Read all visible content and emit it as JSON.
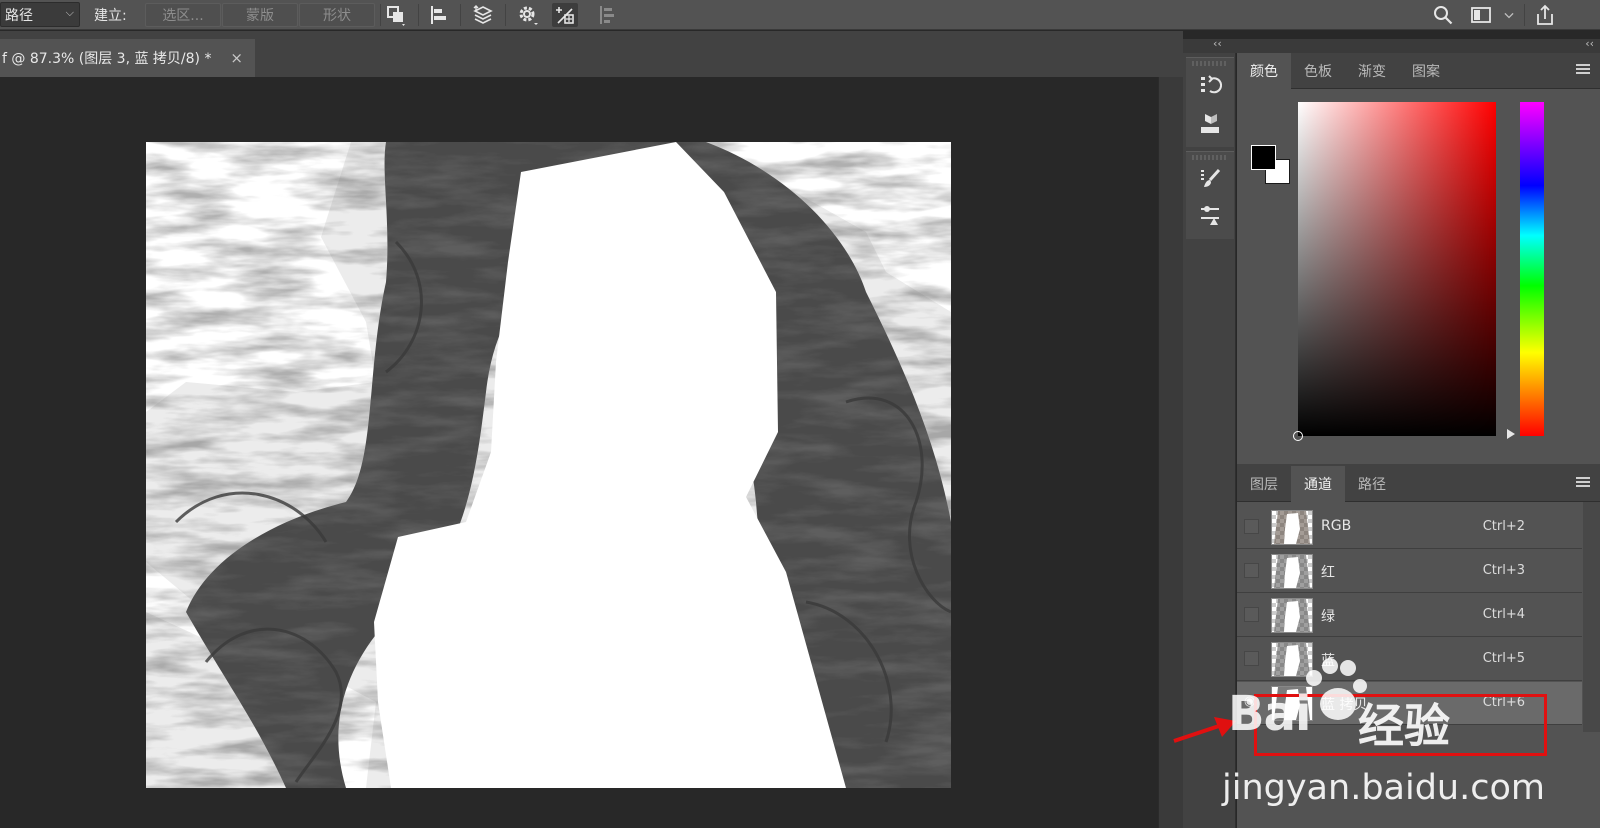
{
  "options_bar": {
    "mode_value": "路径",
    "make_label": "建立:",
    "selection_button": "选区...",
    "mask_button": "蒙版",
    "shape_button": "形状",
    "icons": [
      "path-operations-icon",
      "path-alignment-icon",
      "path-arrangement-icon",
      "settings-gear-icon",
      "constrain-path-icon",
      "align-edges-icon",
      "search-icon",
      "workspace-icon",
      "share-icon"
    ]
  },
  "document_tab": {
    "title": "f @ 87.3% (图层 3, 蓝 拷贝/8) *",
    "close": "×"
  },
  "dock": {
    "collapse_left": "‹‹",
    "collapse_right": "‹‹",
    "strip_icons": [
      "history-icon",
      "3d-materials-icon",
      "brush-settings-icon",
      "adjustments-icon"
    ]
  },
  "color_panel": {
    "tabs": [
      "颜色",
      "色板",
      "渐变",
      "图案"
    ],
    "active_tab": "颜色",
    "foreground_color": "#000000",
    "background_color": "#ffffff",
    "hue_color": "#ff0000"
  },
  "channels_panel": {
    "tabs": [
      "图层",
      "通道",
      "路径"
    ],
    "active_tab": "通道",
    "channels": [
      {
        "name": "RGB",
        "shortcut": "Ctrl+2",
        "selected": false
      },
      {
        "name": "红",
        "shortcut": "Ctrl+3",
        "selected": false
      },
      {
        "name": "绿",
        "shortcut": "Ctrl+4",
        "selected": false
      },
      {
        "name": "蓝",
        "shortcut": "Ctrl+5",
        "selected": false
      },
      {
        "name": "蓝 拷贝",
        "shortcut": "Ctrl+6",
        "selected": true
      }
    ]
  },
  "annotation": {
    "highlight_color": "#e01010"
  },
  "watermark": {
    "logo": "Bai  ",
    "brand_cn": "经验",
    "url": "jingyan.baidu.com"
  }
}
